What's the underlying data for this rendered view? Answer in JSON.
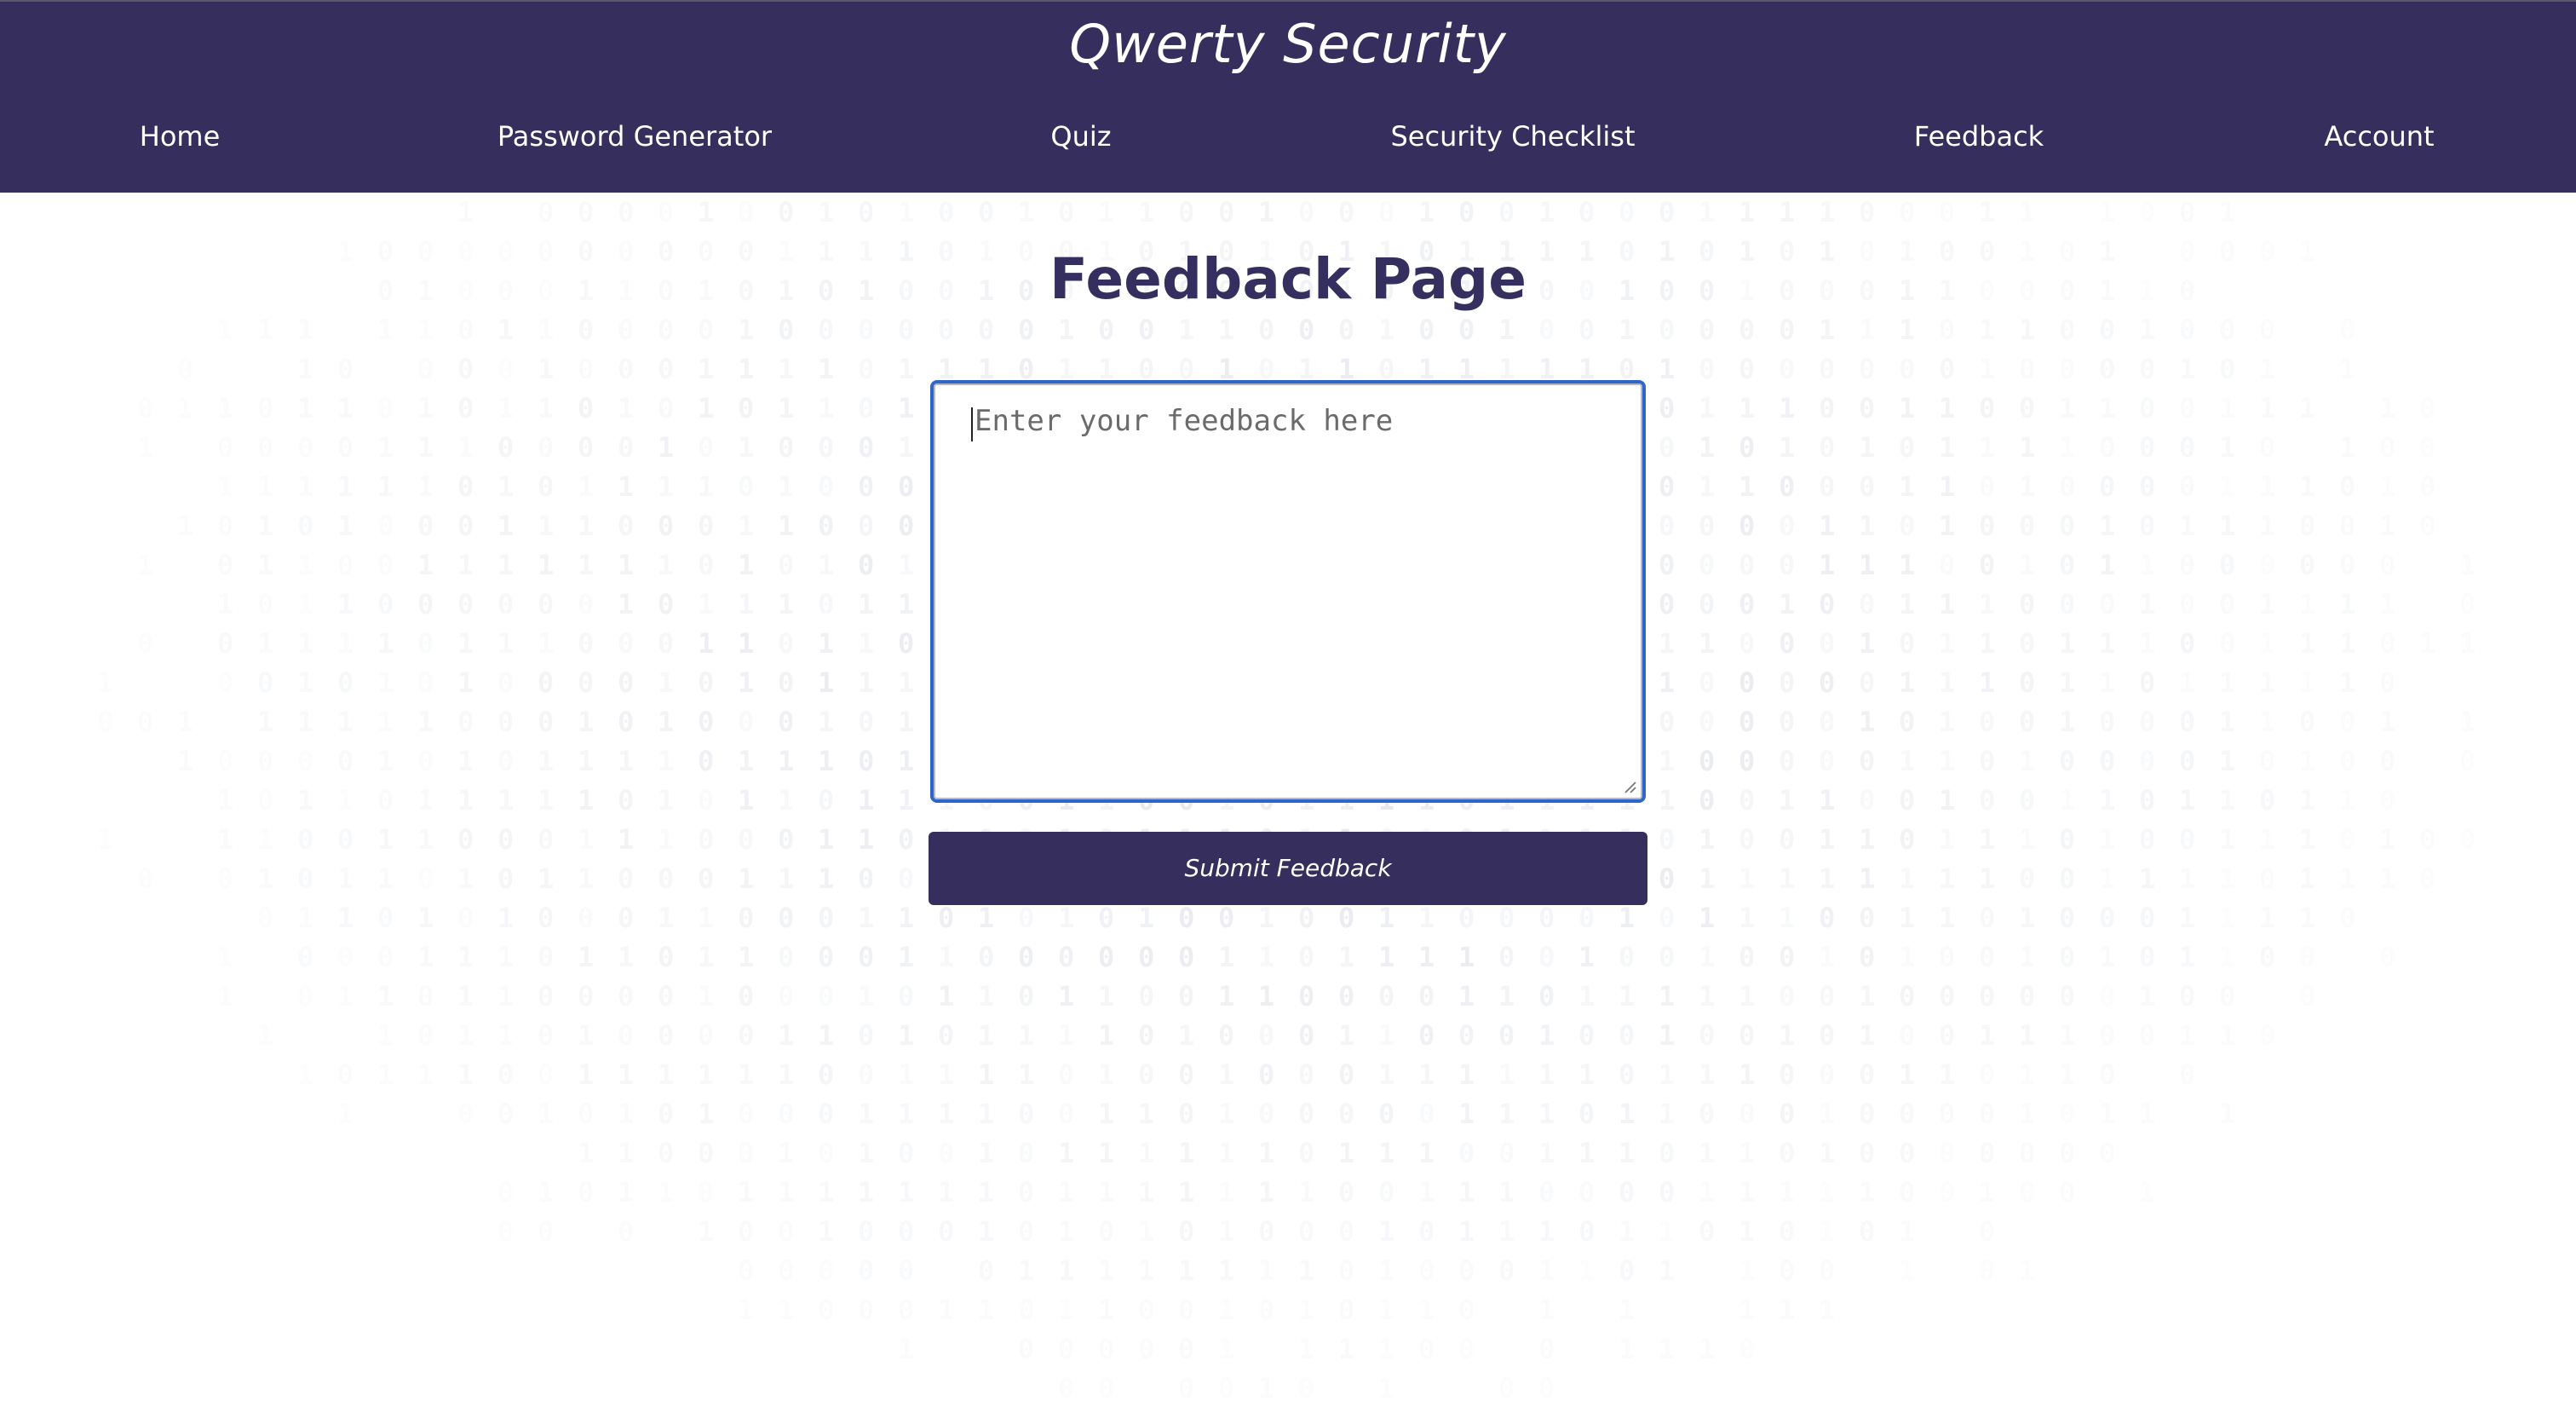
{
  "header": {
    "title": "Qwerty Security",
    "nav": [
      {
        "label": "Home"
      },
      {
        "label": "Password Generator"
      },
      {
        "label": "Quiz"
      },
      {
        "label": "Security Checklist"
      },
      {
        "label": "Feedback"
      },
      {
        "label": "Account"
      }
    ]
  },
  "main": {
    "title": "Feedback Page",
    "feedback": {
      "value": "",
      "placeholder": "Enter your feedback here"
    },
    "submit_label": "Submit Feedback"
  },
  "colors": {
    "header_bg": "#362f5d",
    "title_text": "#342f5e",
    "focus_ring": "#2f64c8",
    "button_bg": "#362f5d",
    "binary_digits": "#c9cbd6"
  },
  "background": {
    "pattern": "binary digits 0 and 1"
  }
}
